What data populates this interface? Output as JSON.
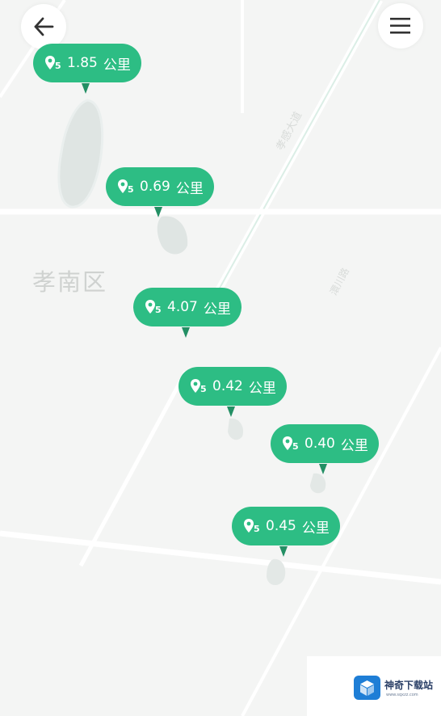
{
  "map": {
    "district_label": "孝南区",
    "road_label_1": "孝感大道",
    "road_label_2": "澴川路"
  },
  "controls": {
    "back_icon": "arrow-left-icon",
    "menu_icon": "hamburger-menu-icon"
  },
  "markers": [
    {
      "value": "1.85",
      "unit": "公里",
      "icon": "pin-5-icon"
    },
    {
      "value": "0.69",
      "unit": "公里",
      "icon": "pin-5-icon"
    },
    {
      "value": "4.07",
      "unit": "公里",
      "icon": "pin-5-icon"
    },
    {
      "value": "0.42",
      "unit": "公里",
      "icon": "pin-5-icon"
    },
    {
      "value": "0.40",
      "unit": "公里",
      "icon": "pin-5-icon"
    },
    {
      "value": "0.45",
      "unit": "公里",
      "icon": "pin-5-icon"
    }
  ],
  "watermark": {
    "name": "神奇下载站",
    "url": "www.sqxzz.com"
  },
  "colors": {
    "marker": "#2dbd84",
    "marker_tail": "#238f64",
    "background": "#f4f5f4"
  }
}
